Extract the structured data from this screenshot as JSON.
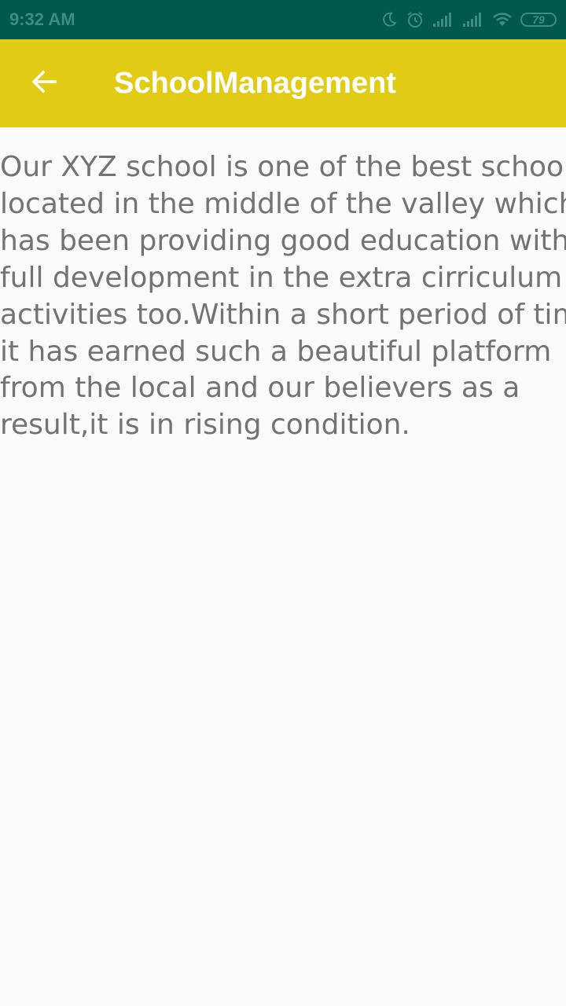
{
  "status_bar": {
    "time": "9:32 AM",
    "battery_level": "79",
    "icons": [
      "moon-icon",
      "alarm-icon",
      "signal-icon",
      "signal-icon",
      "wifi-icon",
      "battery-icon"
    ]
  },
  "app_bar": {
    "title": "SchoolManagement",
    "back_icon": "arrow-left-icon",
    "background_color": "#e1cb15"
  },
  "content": {
    "lines": [
      "Our XYZ school is one of the best school",
      "located in the middle of the valley which",
      "has been providing good education with",
      "full development in the extra cirriculum",
      "activities too.Within a short period of tim",
      "it has earned such a beautiful platform",
      "from the local and our believers as a",
      "result,it is in rising condition."
    ]
  },
  "colors": {
    "status_bar": "#00574b",
    "app_bar": "#e1cb15",
    "text": "#737373",
    "background": "#fafafa"
  }
}
